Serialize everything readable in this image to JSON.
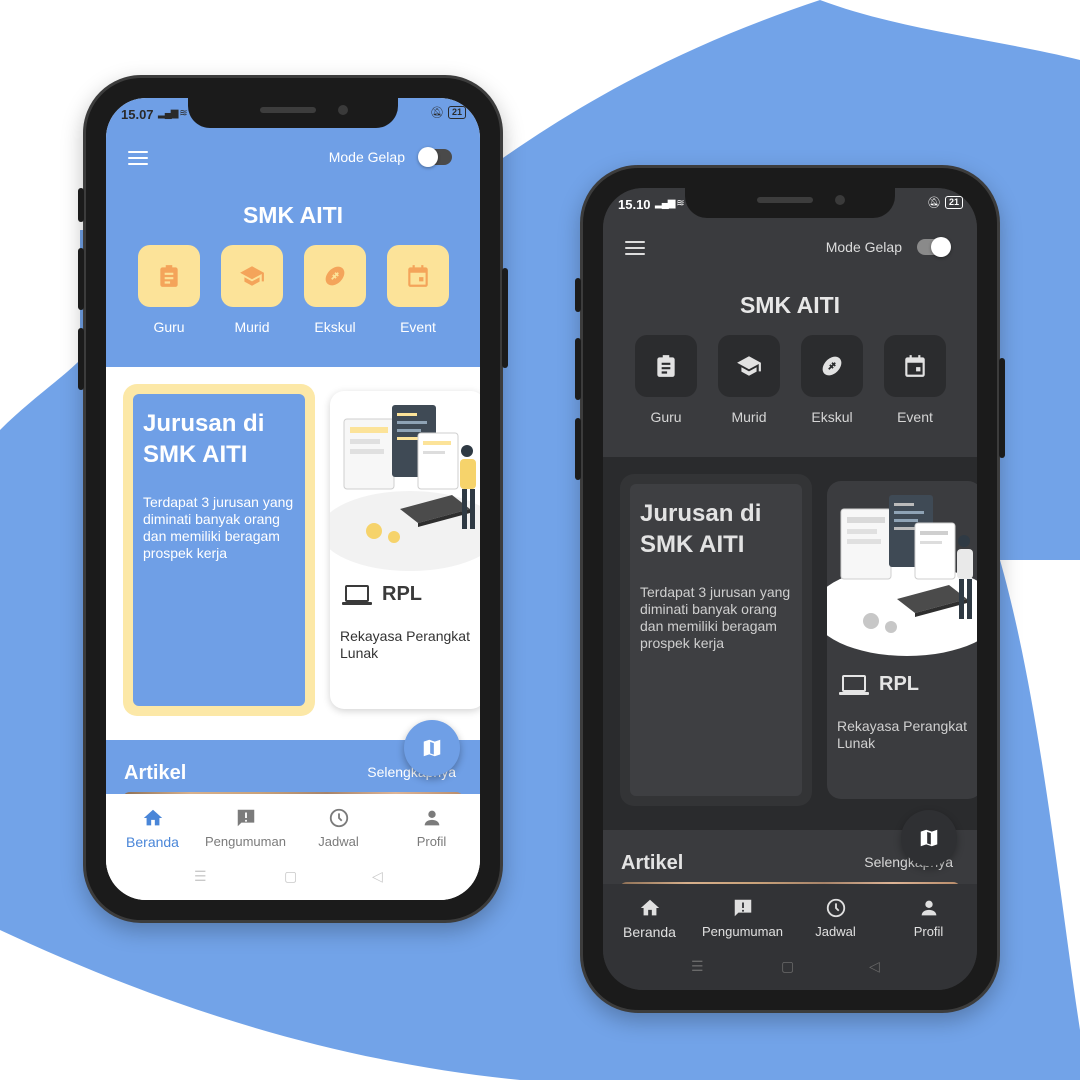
{
  "background": {
    "wave_color": "#72a3e8",
    "base_color": "#ffffff"
  },
  "phones": [
    {
      "theme": "light",
      "status": {
        "time": "15.07",
        "battery": "21"
      },
      "header": {
        "mode_label": "Mode Gelap",
        "mode_on": false,
        "title": "SMK AITI"
      },
      "categories": [
        {
          "label": "Guru",
          "icon": "clipboard-icon"
        },
        {
          "label": "Murid",
          "icon": "graduation-cap-icon"
        },
        {
          "label": "Ekskul",
          "icon": "football-icon"
        },
        {
          "label": "Event",
          "icon": "calendar-icon"
        }
      ],
      "intro": {
        "heading": "Jurusan di SMK AITI",
        "text": "Terdapat 3 jurusan yang diminati banyak orang dan memiliki beragam prospek kerja"
      },
      "major_card": {
        "code": "RPL",
        "name": "Rekayasa Perangkat Lunak",
        "icon": "laptop-icon"
      },
      "articles": {
        "heading": "Artikel",
        "more_label": "Selengkapnya"
      },
      "fab_icon": "map-icon",
      "nav": [
        {
          "label": "Beranda",
          "icon": "home-icon",
          "active": true
        },
        {
          "label": "Pengumuman",
          "icon": "announcement-icon",
          "active": false
        },
        {
          "label": "Jadwal",
          "icon": "clock-icon",
          "active": false
        },
        {
          "label": "Profil",
          "icon": "person-icon",
          "active": false
        }
      ]
    },
    {
      "theme": "dark",
      "status": {
        "time": "15.10",
        "battery": "21"
      },
      "header": {
        "mode_label": "Mode Gelap",
        "mode_on": true,
        "title": "SMK AITI"
      },
      "categories": [
        {
          "label": "Guru",
          "icon": "clipboard-icon"
        },
        {
          "label": "Murid",
          "icon": "graduation-cap-icon"
        },
        {
          "label": "Ekskul",
          "icon": "football-icon"
        },
        {
          "label": "Event",
          "icon": "calendar-icon"
        }
      ],
      "intro": {
        "heading": "Jurusan di SMK AITI",
        "text": "Terdapat 3 jurusan yang diminati banyak orang dan memiliki beragam prospek kerja"
      },
      "major_card": {
        "code": "RPL",
        "name": "Rekayasa Perangkat Lunak",
        "icon": "laptop-icon"
      },
      "articles": {
        "heading": "Artikel",
        "more_label": "Selengkapnya"
      },
      "fab_icon": "map-icon",
      "nav": [
        {
          "label": "Beranda",
          "icon": "home-icon",
          "active": true
        },
        {
          "label": "Pengumuman",
          "icon": "announcement-icon",
          "active": false
        },
        {
          "label": "Jadwal",
          "icon": "clock-icon",
          "active": false
        },
        {
          "label": "Profil",
          "icon": "person-icon",
          "active": false
        }
      ]
    }
  ],
  "colors": {
    "primary_blue": "#6f9fe6",
    "accent_yellow": "#fce399",
    "icon_orange": "#f4a45a",
    "dark_bg": "#2e2f31"
  }
}
